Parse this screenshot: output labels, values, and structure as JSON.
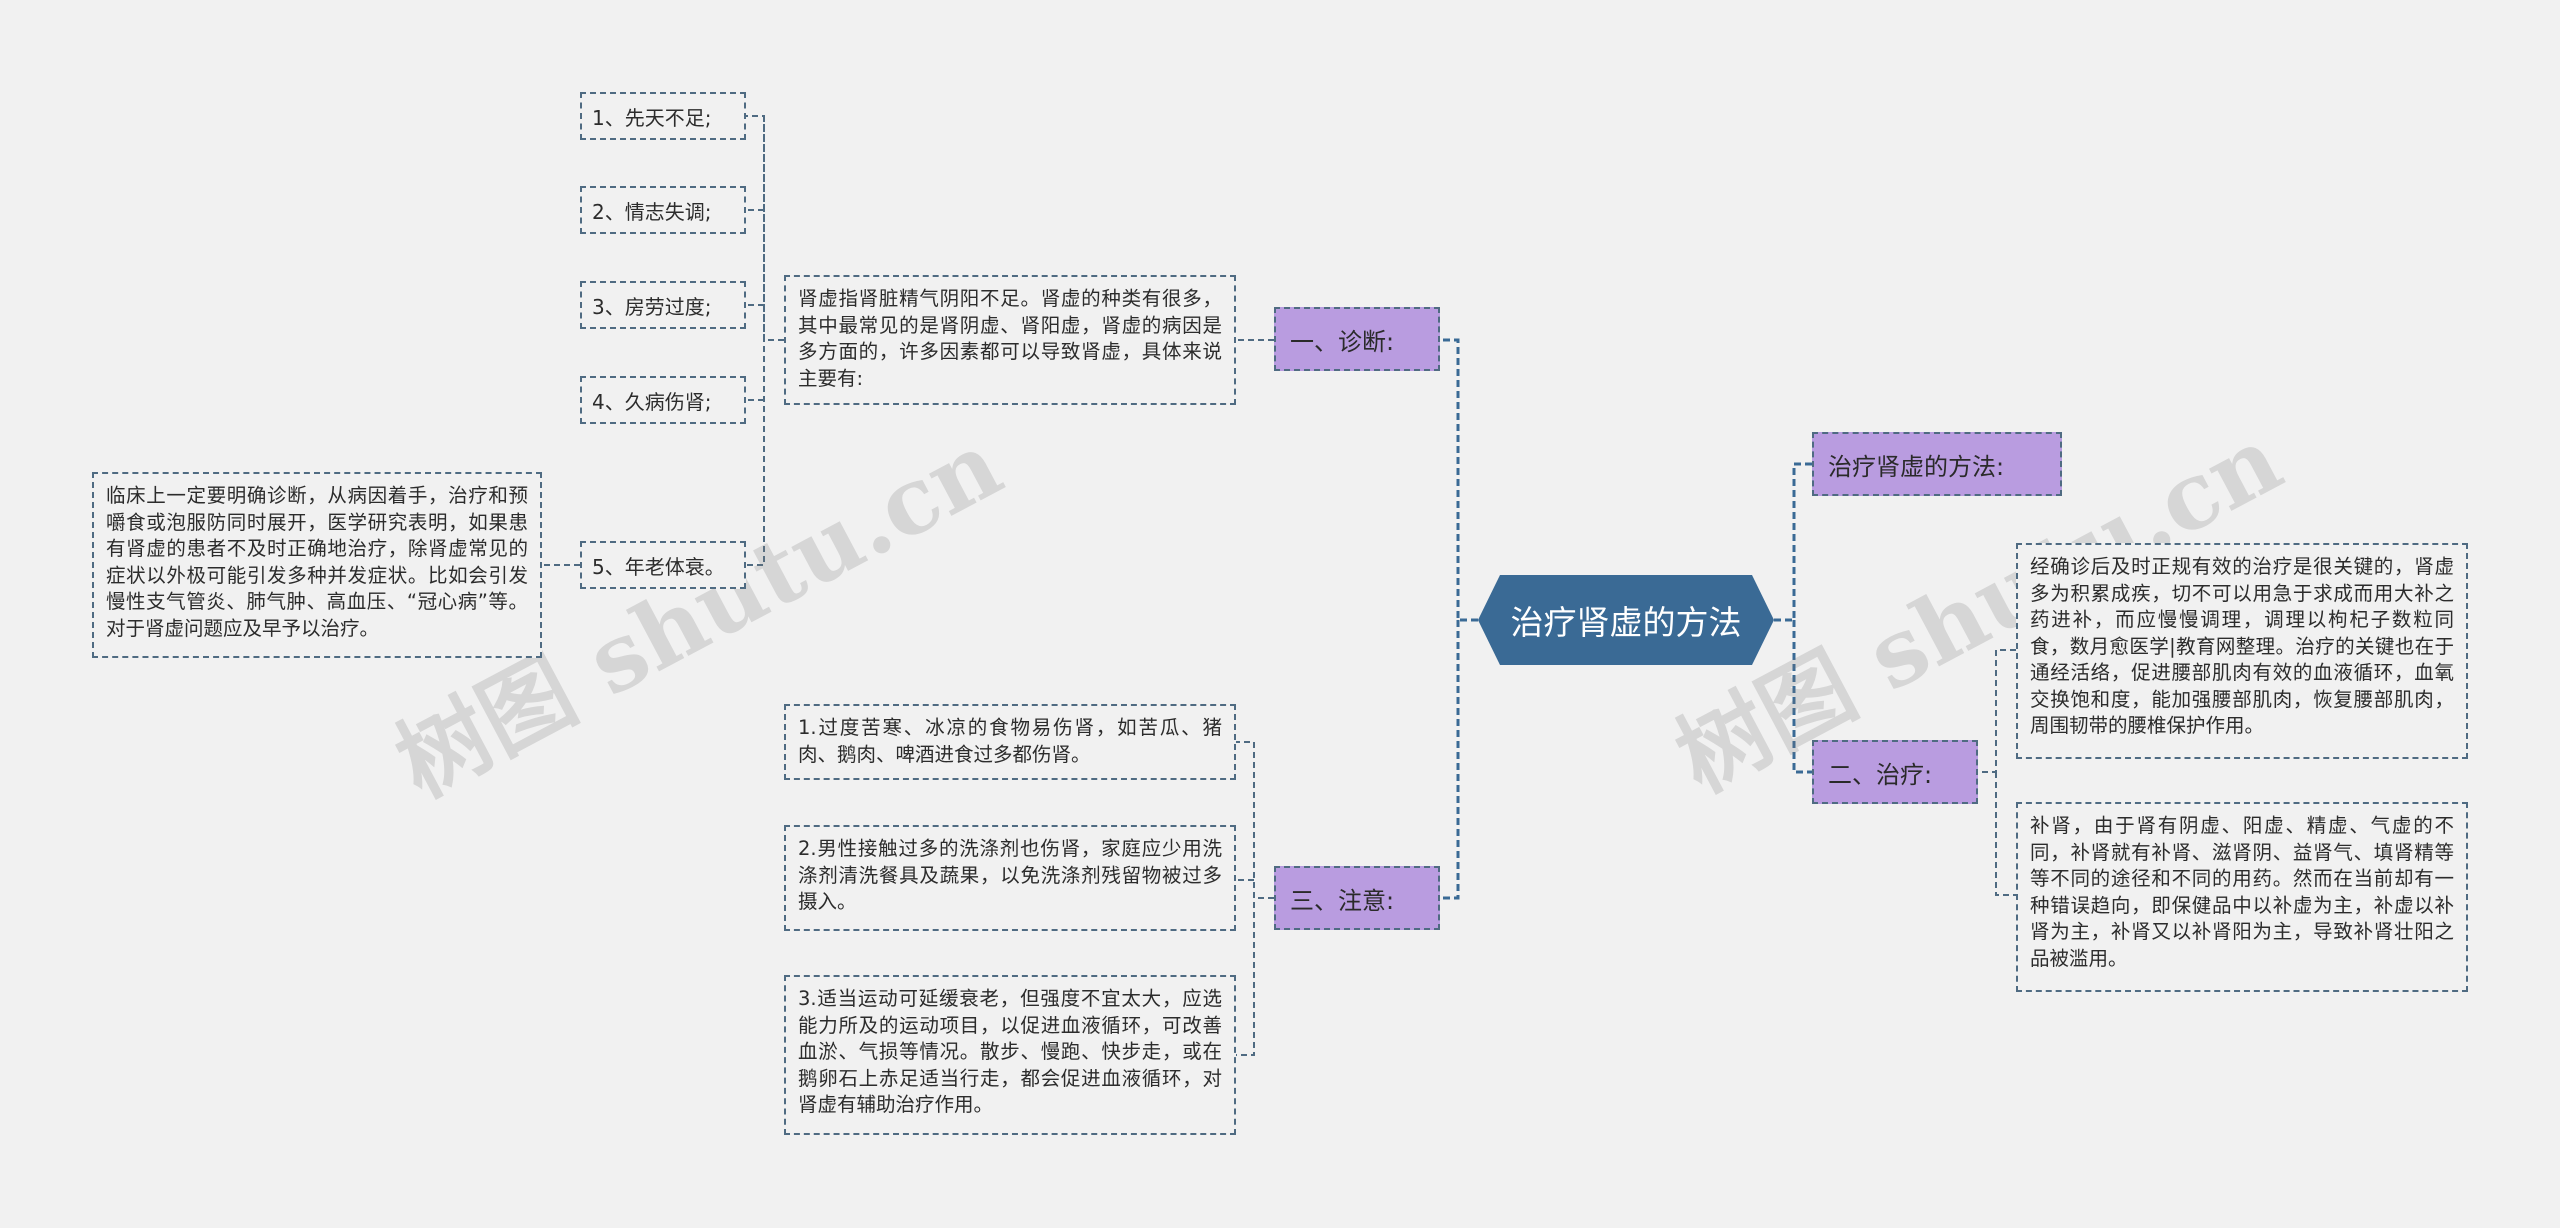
{
  "root": {
    "label": "治疗肾虚的方法"
  },
  "branches": {
    "diagnosis": {
      "label": "一、诊断:",
      "intro": "肾虚指肾脏精气阴阳不足。肾虚的种类有很多，其中最常见的是肾阴虚、肾阳虚，肾虚的病因是多方面的，许多因素都可以导致肾虚，具体来说主要有:",
      "causes": [
        "1、先天不足;",
        "2、情志失调;",
        "3、房劳过度;",
        "4、久病伤肾;",
        "5、年老体衰。"
      ],
      "note": "临床上一定要明确诊断，从病因着手，治疗和预嚼食或泡服防同时展开，医学研究表明，如果患有肾虚的患者不及时正确地治疗，除肾虚常见的症状以外极可能引发多种并发症状。比如会引发慢性支气管炎、肺气肿、高血压、“冠心病”等。对于肾虚问题应及早予以治疗。"
    },
    "attention": {
      "label": "三、注意:",
      "items": [
        "1.过度苦寒、冰凉的食物易伤肾，如苦瓜、猪肉、鹅肉、啤酒进食过多都伤肾。",
        "2.男性接触过多的洗涤剂也伤肾，家庭应少用洗涤剂清洗餐具及蔬果，以免洗涤剂残留物被过多摄入。",
        "3.适当运动可延缓衰老，但强度不宜太大，应选能力所及的运动项目，以促进血液循环，可改善血淤、气损等情况。散步、慢跑、快步走，或在鹅卵石上赤足适当行走，都会促进血液循环，对肾虚有辅助治疗作用。"
      ]
    },
    "method": {
      "label": "治疗肾虚的方法:"
    },
    "treatment": {
      "label": "二、治疗:",
      "items": [
        "经确诊后及时正规有效的治疗是很关键的，肾虚多为积累成疾，切不可以用急于求成而用大补之药进补，而应慢慢调理，调理以枸杞子数粒同食，数月愈医学|教育网整理。治疗的关键也在于通经活络，促进腰部肌肉有效的血液循环，血氧交换饱和度，能加强腰部肌肉，恢复腰部肌肉，周围韧带的腰椎保护作用。",
        "补肾，由于肾有阴虚、阳虚、精虚、气虚的不同，补肾就有补肾、滋肾阴、益肾气、填肾精等等不同的途径和不同的用药。然而在当前却有一种错误趋向，即保健品中以补虚为主，补虚以补肾为主，补肾又以补肾阳为主，导致补肾壮阳之品被滥用。"
      ]
    }
  },
  "watermark": [
    "树图 shutu.cn",
    "树图 shutu.cn"
  ],
  "colors": {
    "background": "#f1f1f1",
    "root": "#3a6a95",
    "category": "#b99ce0",
    "border": "#4f6b82"
  }
}
